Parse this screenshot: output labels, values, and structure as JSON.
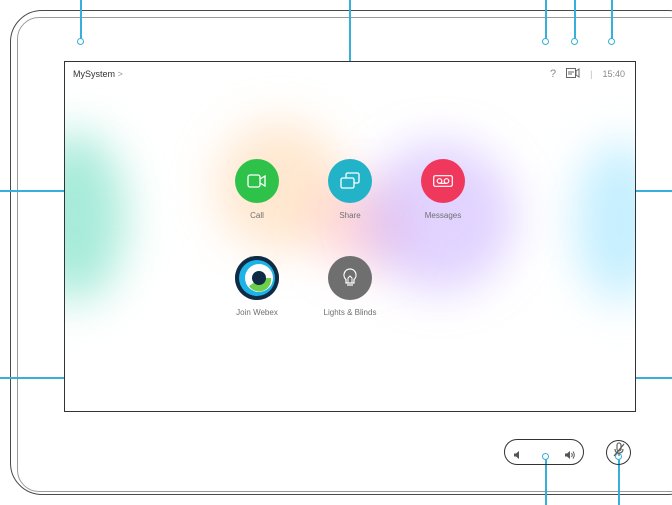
{
  "topbar": {
    "system_name": "MySystem",
    "chevron": ">",
    "help_glyph": "?",
    "separator": "|",
    "time": "15:40"
  },
  "apps": {
    "call": {
      "label": "Call",
      "icon": "video-camera-icon",
      "color": "#2fc24a"
    },
    "share": {
      "label": "Share",
      "icon": "share-screens-icon",
      "color": "#22b3c8"
    },
    "messages": {
      "label": "Messages",
      "icon": "voicemail-icon",
      "color": "#f0385c"
    },
    "webex": {
      "label": "Join Webex",
      "icon": "webex-logo-icon"
    },
    "lights": {
      "label": "Lights & Blinds",
      "icon": "lightbulb-icon",
      "color": "#6f6f6f"
    }
  },
  "hardware": {
    "volume_icon": "volume-icon",
    "mute_icon": "microphone-muted-icon"
  },
  "colors": {
    "callout": "#36b0da"
  }
}
